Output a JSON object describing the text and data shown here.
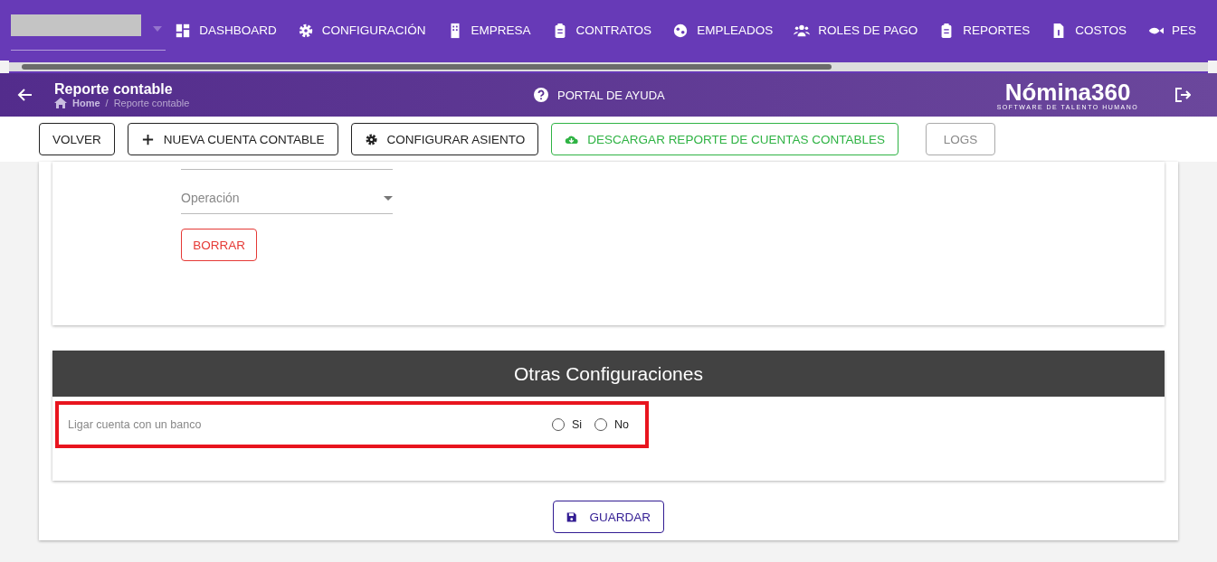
{
  "nav": {
    "items": [
      {
        "label": "DASHBOARD",
        "kind": "dashboard"
      },
      {
        "label": "CONFIGURACIÓN",
        "kind": "gear"
      },
      {
        "label": "EMPRESA",
        "kind": "building"
      },
      {
        "label": "CONTRATOS",
        "kind": "clipboard"
      },
      {
        "label": "EMPLEADOS",
        "kind": "globe"
      },
      {
        "label": "ROLES DE PAGO",
        "kind": "users"
      },
      {
        "label": "REPORTES",
        "kind": "clipboard"
      },
      {
        "label": "COSTOS",
        "kind": "invoice"
      },
      {
        "label": "PES",
        "kind": "fish"
      }
    ]
  },
  "header": {
    "title": "Reporte contable",
    "breadcrumb": [
      "Home",
      "/",
      "Reporte contable"
    ],
    "help": "PORTAL DE AYUDA",
    "logo": "Nómina360",
    "logo_tagline": "SOFTWARE DE TALENTO HUMANO"
  },
  "toolbar": [
    {
      "label": "VOLVER",
      "kind": "plain"
    },
    {
      "label": "NUEVA CUENTA CONTABLE",
      "kind": "plus"
    },
    {
      "label": "CONFIGURAR ASIENTO",
      "kind": "gear"
    },
    {
      "label": "DESCARGAR REPORTE DE CUENTAS CONTABLES",
      "kind": "download"
    },
    {
      "label": "LOGS",
      "kind": "muted"
    }
  ],
  "form": {
    "operation_placeholder": "Operación",
    "delete": "BORRAR"
  },
  "other": {
    "title": "Otras Configuraciones",
    "question": "Ligar cuenta con un banco",
    "options": [
      {
        "label": "Si",
        "selected": false
      },
      {
        "label": "No",
        "selected": false
      }
    ]
  },
  "save": "GUARDAR"
}
